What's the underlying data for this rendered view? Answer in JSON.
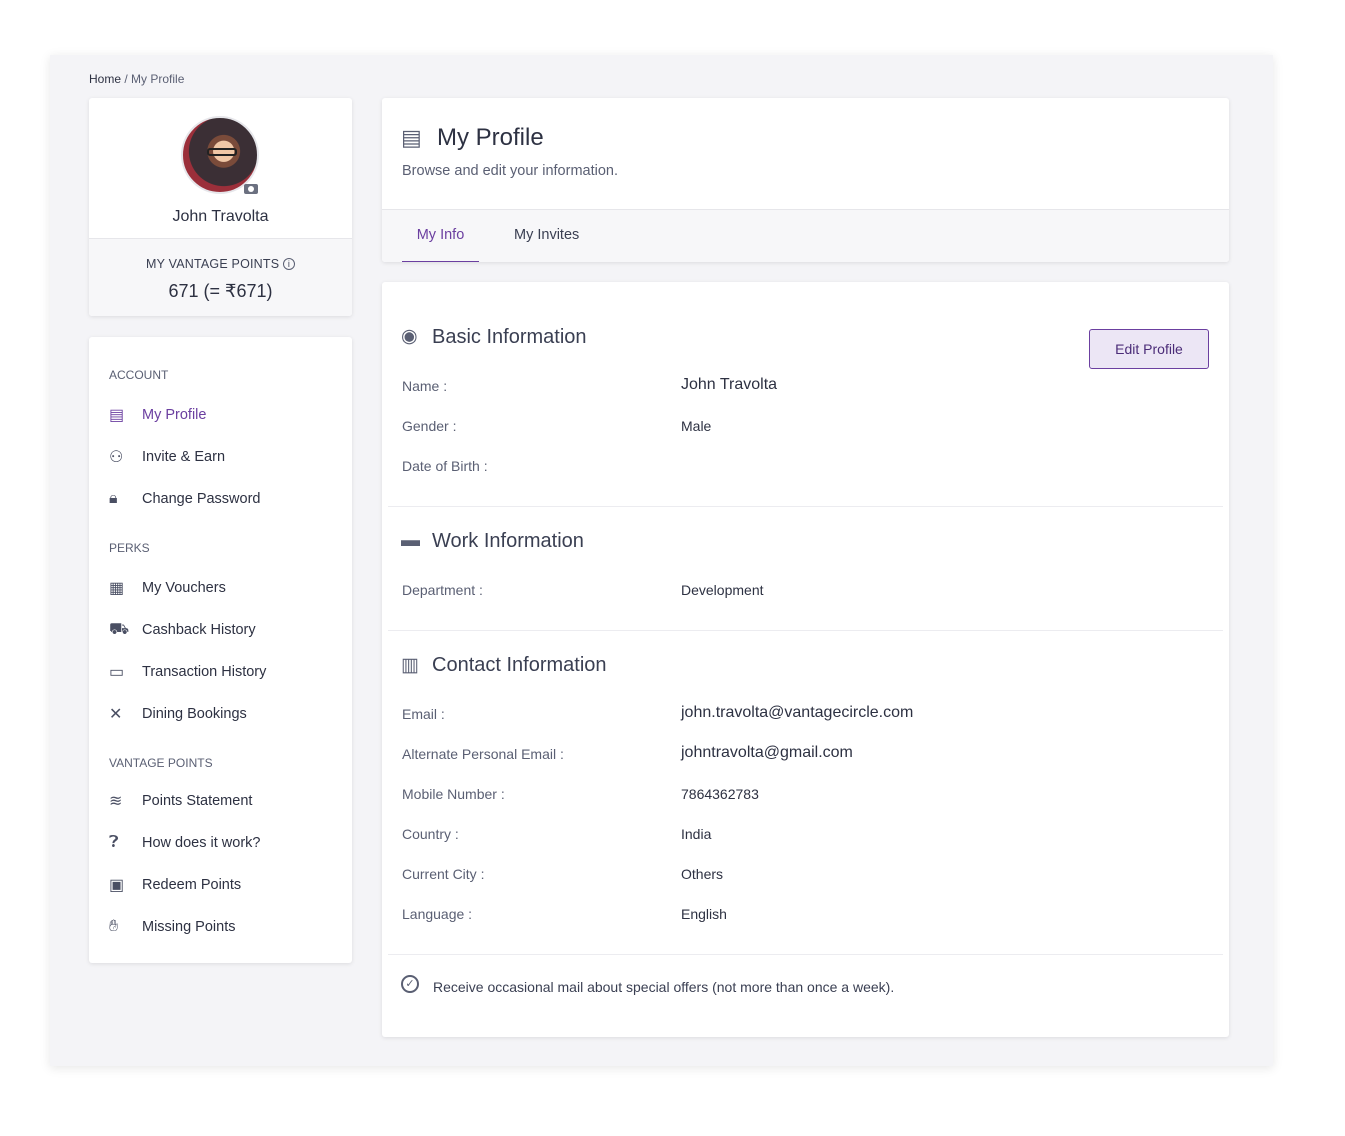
{
  "breadcrumb": {
    "home": "Home",
    "separator": " / ",
    "current": "My Profile"
  },
  "user": {
    "name": "John Travolta",
    "points_label": "MY VANTAGE POINTS",
    "points_value": "671 (= ₹671)"
  },
  "sidebar": {
    "sections": [
      {
        "title": "ACCOUNT",
        "items": [
          {
            "label": "My Profile",
            "icon": "profile-doc-icon",
            "active": true
          },
          {
            "label": "Invite & Earn",
            "icon": "add-user-icon"
          },
          {
            "label": "Change Password",
            "icon": "lock-icon"
          }
        ]
      },
      {
        "title": "PERKS",
        "items": [
          {
            "label": "My Vouchers",
            "icon": "voucher-icon"
          },
          {
            "label": "Cashback History",
            "icon": "cart-icon"
          },
          {
            "label": "Transaction History",
            "icon": "card-icon"
          },
          {
            "label": "Dining Bookings",
            "icon": "fork-knife-icon"
          }
        ]
      },
      {
        "title": "VANTAGE POINTS",
        "items": [
          {
            "label": "Points Statement",
            "icon": "coins-icon"
          },
          {
            "label": "How does it work?",
            "icon": "question-icon"
          },
          {
            "label": "Redeem Points",
            "icon": "gift-icon"
          },
          {
            "label": "Missing Points",
            "icon": "hand-icon"
          }
        ]
      }
    ]
  },
  "header": {
    "title": "My Profile",
    "subtitle": "Browse and edit your information.",
    "tabs": [
      {
        "label": "My Info",
        "active": true
      },
      {
        "label": "My Invites"
      }
    ]
  },
  "basic": {
    "title": "Basic Information",
    "edit_label": "Edit Profile",
    "rows": [
      {
        "label": "Name :",
        "value": "John Travolta"
      },
      {
        "label": "Gender :",
        "value": "Male"
      },
      {
        "label": "Date of Birth :",
        "value": ""
      }
    ]
  },
  "work": {
    "title": "Work Information",
    "rows": [
      {
        "label": "Department :",
        "value": "Development"
      }
    ]
  },
  "contact": {
    "title": "Contact Information",
    "rows": [
      {
        "label": "Email :",
        "value": "john.travolta@vantagecircle.com"
      },
      {
        "label": "Alternate Personal Email :",
        "value": "johntravolta@gmail.com"
      },
      {
        "label": "Mobile Number :",
        "value": "7864362783"
      },
      {
        "label": "Country :",
        "value": "India"
      },
      {
        "label": "Current City :",
        "value": "Others"
      },
      {
        "label": "Language :",
        "value": "English"
      }
    ]
  },
  "subscription": {
    "text": "Receive occasional mail about special offers (not more than once a week)."
  },
  "colors": {
    "accent": "#6b3fa0",
    "background": "#f4f4f7"
  }
}
